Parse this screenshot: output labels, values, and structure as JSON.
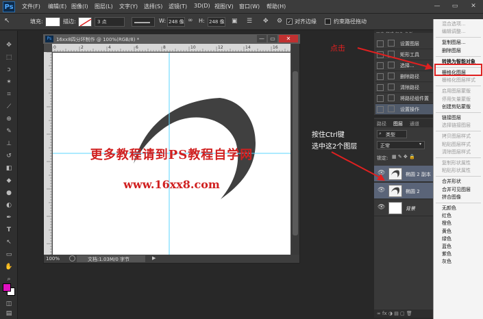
{
  "app": {
    "logo": "Ps"
  },
  "menubar": {
    "items": [
      "文件(F)",
      "编辑(E)",
      "图像(I)",
      "图层(L)",
      "文字(Y)",
      "选择(S)",
      "滤镜(T)",
      "3D(D)",
      "视图(V)",
      "窗口(W)",
      "帮助(H)"
    ],
    "win_controls": [
      "—",
      "▭",
      "✕"
    ]
  },
  "options": {
    "fill_label": "填充:",
    "stroke_label": "描边:",
    "stroke_width": "3 点",
    "w_label": "W:",
    "w_value": "248 像",
    "h_label": "H:",
    "h_value": "248 像",
    "align_edges": "对齐边缘",
    "constrain_path": "约束路径拖动"
  },
  "document": {
    "title": "16xx8四分环制作 @ 100%(RGB/8) *",
    "zoom": "100%",
    "status": "文档:1.03M/0 字节",
    "ruler_ticks": [
      "0",
      "2",
      "4",
      "6",
      "8",
      "10",
      "12",
      "14",
      "16"
    ],
    "watermark_line1": "更多教程请到PS教程自学网",
    "watermark_line2": "www.16xx8.com"
  },
  "actions": {
    "rows": [
      "设置图层",
      "矩形工具",
      "选择...",
      "删除路径",
      "清除路径",
      "将路径组件置",
      "设置操作"
    ]
  },
  "layers": {
    "tabs": [
      "路径",
      "图层",
      "通道"
    ],
    "kind_label": "类型",
    "blend_mode": "正常",
    "lock_label": "锁定:",
    "rows": [
      {
        "name": "椭圆 2 副本",
        "selected": true
      },
      {
        "name": "椭圆 2",
        "selected": true
      },
      {
        "name": "背景",
        "selected": false
      }
    ]
  },
  "context_menu": {
    "items": [
      {
        "label": "混合选项...",
        "enabled": false
      },
      {
        "label": "编辑调整...",
        "enabled": false
      },
      {
        "sep": true
      },
      {
        "label": "复制图层...",
        "enabled": true
      },
      {
        "label": "删除图层",
        "enabled": true
      },
      {
        "sep": true
      },
      {
        "label": "转换为智能对象",
        "enabled": true,
        "highlight": true
      },
      {
        "sep": true
      },
      {
        "label": "栅格化图层",
        "enabled": true
      },
      {
        "label": "栅格化图层样式",
        "enabled": false
      },
      {
        "sep": true
      },
      {
        "label": "启用图层蒙版",
        "enabled": false
      },
      {
        "label": "停用矢量蒙版",
        "enabled": false
      },
      {
        "label": "创建剪贴蒙版",
        "enabled": true
      },
      {
        "sep": true
      },
      {
        "label": "链接图层",
        "enabled": true
      },
      {
        "label": "选择链接图层",
        "enabled": false
      },
      {
        "sep": true
      },
      {
        "label": "拷贝图层样式",
        "enabled": false
      },
      {
        "label": "粘贴图层样式",
        "enabled": false
      },
      {
        "label": "清除图层样式",
        "enabled": false
      },
      {
        "sep": true
      },
      {
        "label": "复制形状属性",
        "enabled": false
      },
      {
        "label": "粘贴形状属性",
        "enabled": false
      },
      {
        "sep": true
      },
      {
        "label": "合并形状",
        "enabled": true
      },
      {
        "label": "合并可见图层",
        "enabled": true
      },
      {
        "label": "拼合图像",
        "enabled": true
      },
      {
        "sep": true
      },
      {
        "label": "无颜色",
        "enabled": true
      },
      {
        "label": "红色",
        "enabled": true
      },
      {
        "label": "橙色",
        "enabled": true
      },
      {
        "label": "黄色",
        "enabled": true
      },
      {
        "label": "绿色",
        "enabled": true
      },
      {
        "label": "蓝色",
        "enabled": true
      },
      {
        "label": "紫色",
        "enabled": true
      },
      {
        "label": "灰色",
        "enabled": true
      }
    ]
  },
  "annotations": {
    "click": "点击",
    "hint_line1": "按住Ctrl键",
    "hint_line2": "选中这2个图层"
  },
  "colors": {
    "foreground": "#e010c0",
    "background": "#ffffff",
    "accent_red": "#e02020",
    "shape": "#404040"
  }
}
